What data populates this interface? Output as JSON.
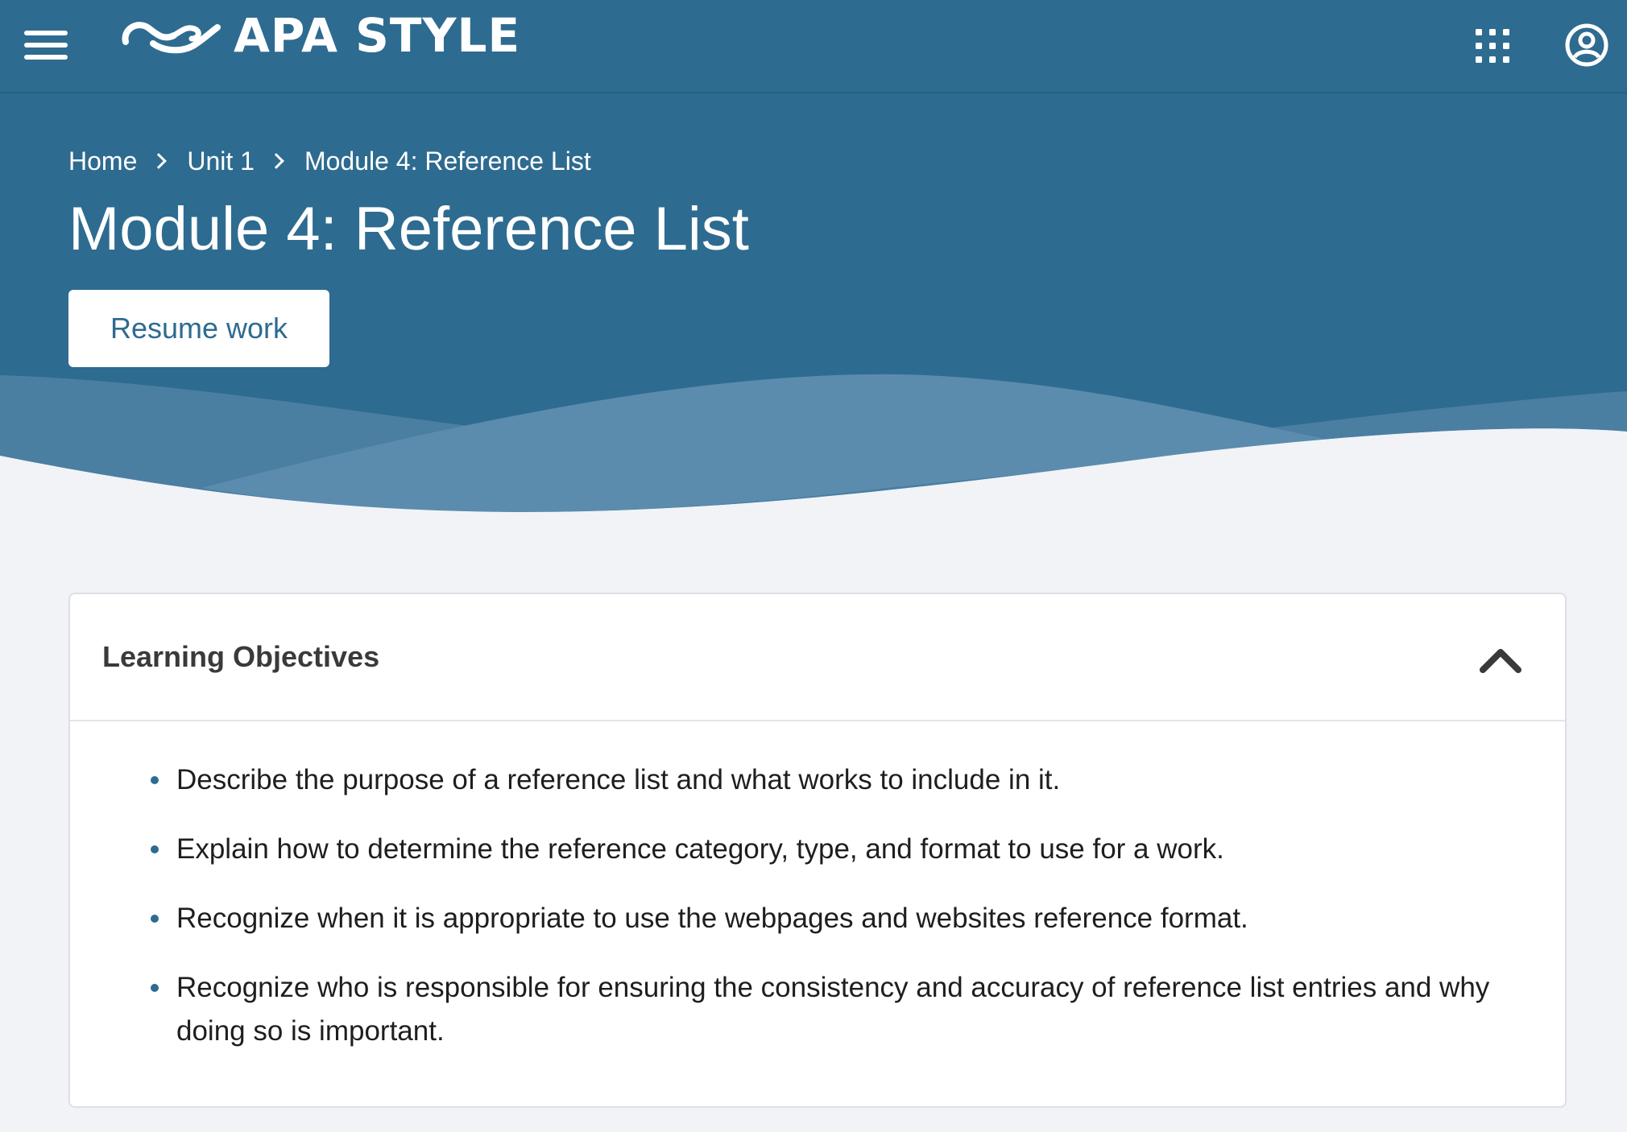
{
  "header": {
    "logo_text": "APA STYLE",
    "menu_icon": "hamburger-menu-icon",
    "apps_icon": "apps-grid-icon",
    "account_icon": "user-account-icon"
  },
  "breadcrumb": {
    "items": [
      "Home",
      "Unit 1",
      "Module 4: Reference List"
    ]
  },
  "page": {
    "title": "Module 4: Reference List",
    "resume_label": "Resume work"
  },
  "learning_objectives": {
    "title": "Learning Objectives",
    "toggle_icon": "chevron-up-icon",
    "items": [
      "Describe the purpose of a reference list and what works to include in it.",
      "Explain how to determine the reference category, type, and format to use for a work.",
      "Recognize when it is appropriate to use the webpages and websites reference format.",
      "Recognize who is responsible for ensuring the consistency and accuracy of reference list entries and why doing so is important."
    ]
  },
  "colors": {
    "brand_blue": "#2e6b90",
    "wave_light": "#6b98b6",
    "page_background": "#f2f3f7",
    "bullet": "#2e6b90"
  }
}
